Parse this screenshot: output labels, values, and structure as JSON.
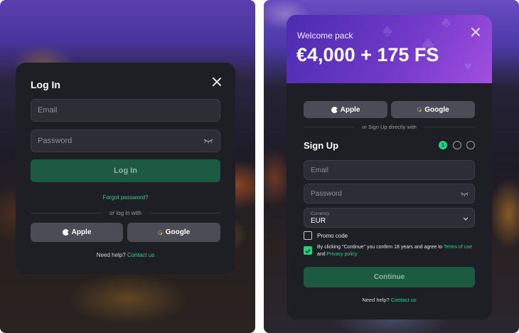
{
  "login": {
    "title": "Log In",
    "email_placeholder": "Email",
    "password_placeholder": "Password",
    "submit_label": "Log In",
    "forgot_label": "Forgot password?",
    "alt_label": "or log in with",
    "apple_label": "Apple",
    "google_label": "Google",
    "help_text": "Need help?",
    "contact_label": "Contact us"
  },
  "signup": {
    "promo_label": "Welcome pack",
    "promo_amount": "€4,000 + 175 FS",
    "apple_label": "Apple",
    "google_label": "Google",
    "alt_label": "or Sign Up directly with",
    "title": "Sign Up",
    "steps": [
      "1",
      "",
      ""
    ],
    "email_placeholder": "Email",
    "password_placeholder": "Password",
    "currency_label": "Currency",
    "currency_value": "EUR",
    "promo_code_label": "Promo code",
    "terms_text": "By clicking \"Continue\" you confirm 18 years and agree to",
    "terms_link": "Terms of use",
    "terms_and": "and",
    "privacy_link": "Privacy policy",
    "continue_label": "Continue",
    "help_text": "Need help?",
    "contact_label": "Contact us"
  },
  "icons": {
    "close": "close-icon",
    "eye": "eye-closed-icon",
    "apple": "apple-icon",
    "google": "google-icon",
    "chevron": "chevron-down-icon",
    "checkbox": "checkmark-icon"
  },
  "colors": {
    "accent": "#29d285",
    "primary_button": "#1d5a42",
    "modal_bg": "#1e1f24",
    "field_bg": "#2d2e35",
    "promo_start": "#4a2cae",
    "promo_end": "#a24fe0"
  }
}
